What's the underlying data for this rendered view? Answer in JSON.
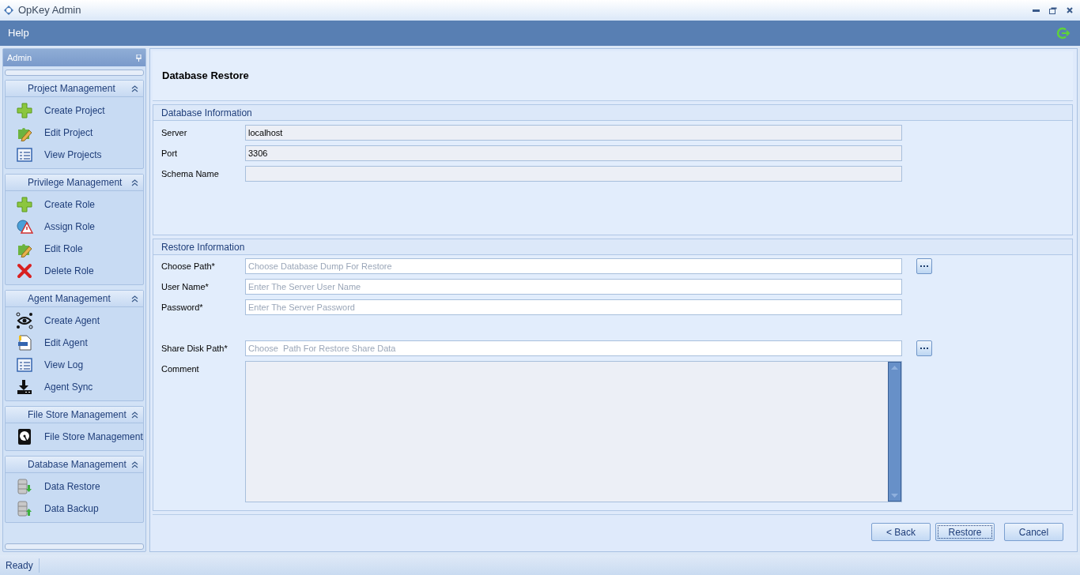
{
  "window": {
    "title": "OpKey Admin"
  },
  "menu": [
    "Help"
  ],
  "sidebar": {
    "title": "Admin",
    "groups": [
      {
        "title": "Project Management",
        "expanded": true,
        "items": [
          {
            "label": "Create Project",
            "kind": "plus"
          },
          {
            "label": "Edit Project",
            "kind": "edit"
          },
          {
            "label": "View Projects",
            "kind": "list"
          }
        ]
      },
      {
        "title": "Privilege Management",
        "expanded": true,
        "items": [
          {
            "label": "Create Role",
            "kind": "plus"
          },
          {
            "label": "Assign Role",
            "kind": "assign"
          },
          {
            "label": "Edit Role",
            "kind": "edit"
          },
          {
            "label": "Delete Role",
            "kind": "delete"
          }
        ]
      },
      {
        "title": "Agent Management",
        "expanded": true,
        "items": [
          {
            "label": "Create Agent",
            "kind": "eye"
          },
          {
            "label": "Edit Agent",
            "kind": "doc"
          },
          {
            "label": "View Log",
            "kind": "list"
          },
          {
            "label": "Agent Sync",
            "kind": "download"
          }
        ]
      },
      {
        "title": "File Store Management",
        "expanded": true,
        "items": [
          {
            "label": "File Store Management",
            "kind": "disk"
          }
        ]
      },
      {
        "title": "Database Management",
        "expanded": true,
        "items": [
          {
            "label": "Data Restore",
            "kind": "dbdown"
          },
          {
            "label": "Data Backup",
            "kind": "dbup"
          }
        ]
      }
    ]
  },
  "page_title": "Database Restore",
  "database_information": {
    "title": "Database Information",
    "fields": [
      {
        "label": "Server",
        "value": "localhost",
        "disabled": true
      },
      {
        "label": "Port",
        "value": "3306",
        "disabled": true
      },
      {
        "label": "Schema Name",
        "disabled": true
      }
    ]
  },
  "restore_information": {
    "title": "Restore Information",
    "fields": [
      {
        "label": "Choose Path*",
        "placeholder": "Choose Database Dump For Restore",
        "kind": "browse"
      },
      {
        "label": "User Name*",
        "placeholder": "Enter The Server User Name",
        "kind": "text"
      },
      {
        "label": "Password*",
        "placeholder": "Enter The Server Password",
        "kind": "text"
      },
      {
        "label": "Share Disk Path*",
        "placeholder": "Choose  Path For Restore Share Data",
        "kind": "browse"
      },
      {
        "label": "Comment",
        "kind": "multiline"
      }
    ]
  },
  "buttons": [
    {
      "label": "< Back",
      "focused": false
    },
    {
      "label": "Restore",
      "focused": true
    },
    {
      "label": "Cancel",
      "focused": false
    }
  ],
  "status_bar": {
    "text": "Ready"
  }
}
